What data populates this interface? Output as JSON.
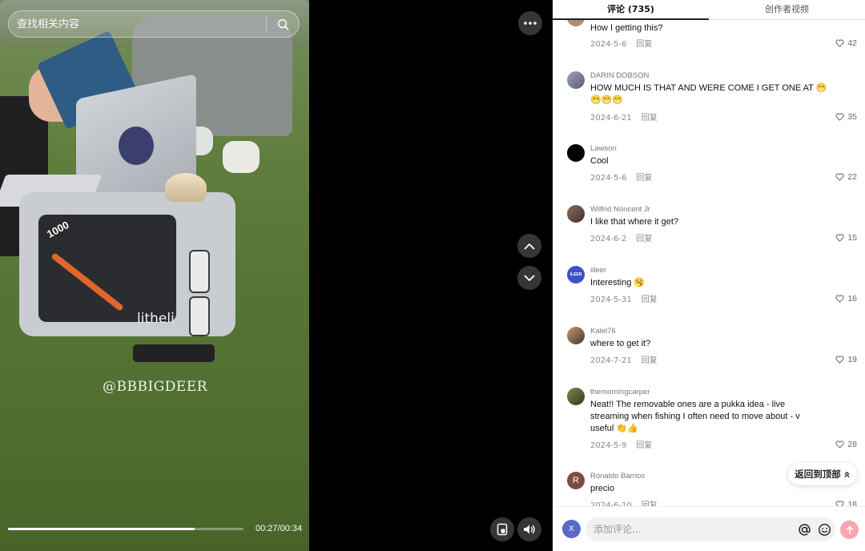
{
  "search": {
    "placeholder": "查找相关内容"
  },
  "video": {
    "watermark": "@BBBIGDEER",
    "time": "00:27/00:34",
    "progress": 0.794,
    "station_label": "1000",
    "brand": "litheli"
  },
  "tabs": [
    {
      "label": "评论 (735)",
      "active": true
    },
    {
      "label": "创作者视频",
      "active": false
    }
  ],
  "comments": [
    {
      "user": "",
      "text": "How I getting this?",
      "date": "2024-5-6",
      "reply": "回复",
      "likes": "42",
      "avatar_color": "#b08c7a"
    },
    {
      "user": "DARIN DOBSON",
      "text": "HOW MUCH IS THAT AND WERE COME I GET ONE AT 😁 😁😁😁",
      "date": "2024-6-21",
      "reply": "回复",
      "likes": "35",
      "avatar_color": "#7b8799"
    },
    {
      "user": "Lawson",
      "text": "Cool",
      "date": "2024-5-6",
      "reply": "回复",
      "likes": "22",
      "avatar_color": "#000000"
    },
    {
      "user": "Wilfrid Noncent Jr",
      "text": "I like that where it get?",
      "date": "2024-6-2",
      "reply": "回复",
      "likes": "15",
      "avatar_color": "#6a5548"
    },
    {
      "user": "iileer",
      "text": "Interesting 🥱",
      "date": "2024-5-31",
      "reply": "回复",
      "likes": "16",
      "avatar_color": "#3f51c7",
      "avatar_text": "iLEER"
    },
    {
      "user": "Kalel76",
      "text": "where to get it?",
      "date": "2024-7-21",
      "reply": "回复",
      "likes": "19",
      "avatar_color": "#8a6d52"
    },
    {
      "user": "themorningcarper",
      "text": "Neat!! The removable ones are a pukka idea - live streaming when fishing I often need to move about - v useful 👏👍",
      "date": "2024-5-9",
      "reply": "回复",
      "likes": "28",
      "avatar_color": "#5c6b3a"
    },
    {
      "user": "Ronaldo Barrios",
      "text": "precio",
      "date": "2024-6-10",
      "reply": "回复",
      "likes": "18",
      "avatar_color": "#7d4d3f",
      "avatar_text": "R"
    }
  ],
  "back_to_top": "返回到顶部",
  "composer": {
    "placeholder": "添加评论...",
    "avatar_text": "X"
  },
  "colors": {
    "accent": "#f7a6ad",
    "like_gray": "#666666"
  }
}
